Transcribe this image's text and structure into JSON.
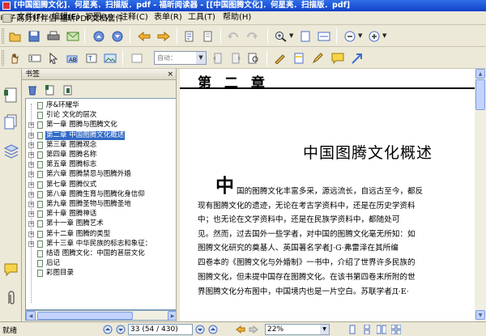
{
  "window": {
    "title": "[中国图腾文化]．何星亮．扫描版．pdf - 福昕阅读器 - [[中国图腾文化]．何星亮．扫描版．pdf]"
  },
  "menubar": {
    "items": [
      "文件(F)",
      "编辑(E)",
      "视图(V)",
      "注释(C)",
      "表单(R)",
      "工具(T)",
      "帮助(H)"
    ],
    "promo": [
      "电子商务好伴侣",
      "福昕PDF文档套件"
    ]
  },
  "toolbar2": {
    "zoom_placeholder": "自动："
  },
  "panel": {
    "title": "书签",
    "close": "×"
  },
  "tree": {
    "selected_index": 3,
    "items": [
      {
        "label": "序&环耀华",
        "expandable": false
      },
      {
        "label": "引论 文化的层次",
        "expandable": false
      },
      {
        "label": "第一章 图腾与图腾文化",
        "expandable": true
      },
      {
        "label": "第二章 中国图腾文化概述",
        "expandable": true
      },
      {
        "label": "第三章 图腾观念",
        "expandable": true
      },
      {
        "label": "第四章 图腾名称",
        "expandable": true
      },
      {
        "label": "第五章 图腾标志",
        "expandable": true
      },
      {
        "label": "第六章 图腾禁忌与图腾外婚",
        "expandable": true
      },
      {
        "label": "第七章 图腾仪式",
        "expandable": true
      },
      {
        "label": "第八章 图腾生育与图腾化身信仰",
        "expandable": true
      },
      {
        "label": "第九章 图腾圣物与图腾圣地",
        "expandable": true
      },
      {
        "label": "第十章 图腾神话",
        "expandable": true
      },
      {
        "label": "第十一章 图腾艺术",
        "expandable": true
      },
      {
        "label": "第十二章 图腾的类型",
        "expandable": true
      },
      {
        "label": "第十三章 中华民族的标志和象征：",
        "expandable": true
      },
      {
        "label": "结语 图腾文化：中国的甚层文化",
        "expandable": false
      },
      {
        "label": "后记",
        "expandable": false
      },
      {
        "label": "彩图目录",
        "expandable": false
      }
    ]
  },
  "document": {
    "chapter_label": "第 二 章",
    "chapter_title": "中国图腾文化概述",
    "dropcap": "中",
    "lines": [
      "国的图腾文化丰富多采，源远流长，自远古至今，都反",
      "现有图腾文化的遗迹，无论在考古学资料中，还是在历史学资料",
      "中；也无论在文学资料中，还是在民族学资料中，都随处可",
      "见。然而，过去国外一些学者，对中国的图腾文化毫无所知：如",
      "图腾文化研究的奠基人、英国著名学者J·G·弗雷泽在其所编",
      "四卷本的《图腾文化与外婚制》一书中，介绍了世界许多民族的",
      "图腾文化，但未提中国存在图腾文化。在该书第四卷末所附的世",
      "界图腾文化分布图中，中国境内也是一片空白。苏联学者Д·Е·"
    ]
  },
  "statusbar": {
    "status": "就绪",
    "page_display": "33 (54 / 430)",
    "zoom": "22%"
  },
  "colors": {
    "titlebar": "#1a4fd6",
    "selection": "#316ac5",
    "promo": "#7a7a7a"
  }
}
